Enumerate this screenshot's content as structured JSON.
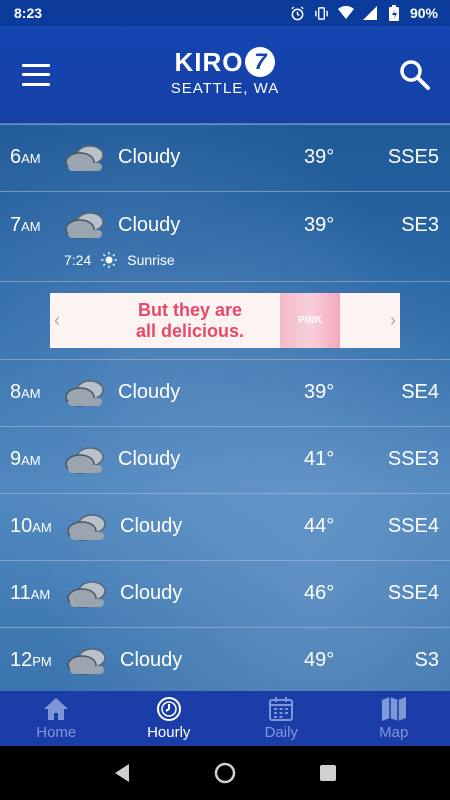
{
  "status_bar": {
    "time": "8:23",
    "battery": "90%"
  },
  "header": {
    "logo_text": "KIRO",
    "logo_number": "7",
    "city": "SEATTLE, WA"
  },
  "hours": [
    {
      "hour": "6",
      "ampm": "AM",
      "condition": "Cloudy",
      "temp": "39°",
      "wind": "SSE5"
    },
    {
      "hour": "7",
      "ampm": "AM",
      "condition": "Cloudy",
      "temp": "39°",
      "wind": "SE3"
    },
    {
      "hour": "8",
      "ampm": "AM",
      "condition": "Cloudy",
      "temp": "39°",
      "wind": "SE4"
    },
    {
      "hour": "9",
      "ampm": "AM",
      "condition": "Cloudy",
      "temp": "41°",
      "wind": "SSE3"
    },
    {
      "hour": "10",
      "ampm": "AM",
      "condition": "Cloudy",
      "temp": "44°",
      "wind": "SSE4"
    },
    {
      "hour": "11",
      "ampm": "AM",
      "condition": "Cloudy",
      "temp": "46°",
      "wind": "SSE4"
    },
    {
      "hour": "12",
      "ampm": "PM",
      "condition": "Cloudy",
      "temp": "49°",
      "wind": "S3"
    }
  ],
  "sunrise": {
    "time": "7:24",
    "label": "Sunrise"
  },
  "ad": {
    "line1": "But they are",
    "line2": "all delicious.",
    "bottle_label": "PINK"
  },
  "tabs": [
    {
      "label": "Home",
      "icon": "home-icon",
      "active": false
    },
    {
      "label": "Hourly",
      "icon": "clock-icon",
      "active": true
    },
    {
      "label": "Daily",
      "icon": "calendar-icon",
      "active": false
    },
    {
      "label": "Map",
      "icon": "map-icon",
      "active": false
    }
  ],
  "colors": {
    "header_blue": "#1445b0",
    "tab_bar_blue": "#1a3da8",
    "ad_pink": "#e8496a"
  }
}
